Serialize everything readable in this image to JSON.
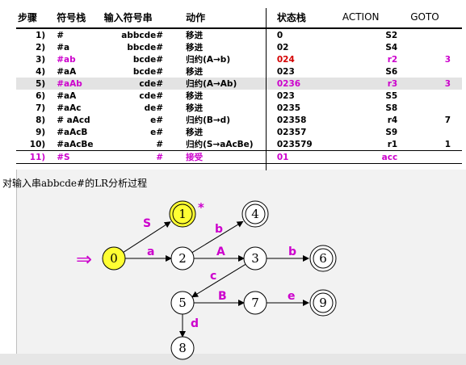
{
  "table": {
    "headers": [
      "步骤",
      "符号栈",
      "输入符号串",
      "动作",
      "状态栈",
      "ACTION",
      "GOTO"
    ],
    "rows": [
      {
        "step": "1)",
        "stack": "#",
        "input": "abbcde#",
        "action": "移进",
        "states": "0",
        "act": "S2",
        "goto": ""
      },
      {
        "step": "2)",
        "stack": "#a",
        "input": "bbcde#",
        "action": "移进",
        "states": "02",
        "act": "S4",
        "goto": ""
      },
      {
        "step": "3)",
        "stack": "#ab",
        "input": "bcde#",
        "action": "归约(A→b)",
        "states": "024",
        "act": "r2",
        "goto": "3"
      },
      {
        "step": "4)",
        "stack": "#aA",
        "input": "bcde#",
        "action": "移进",
        "states": "023",
        "act": "S6",
        "goto": ""
      },
      {
        "step": "5)",
        "stack": "#aAb",
        "input": "cde#",
        "action": "归约(A→Ab)",
        "states": "0236",
        "act": "r3",
        "goto": "3"
      },
      {
        "step": "6)",
        "stack": "#aA",
        "input": "cde#",
        "action": "移进",
        "states": "023",
        "act": "S5",
        "goto": ""
      },
      {
        "step": "7)",
        "stack": "#aAc",
        "input": "de#",
        "action": "移进",
        "states": "0235",
        "act": "S8",
        "goto": ""
      },
      {
        "step": "8)",
        "stack": "# aAcd",
        "input": "e#",
        "action": "归约(B→d)",
        "states": "02358",
        "act": "r4",
        "goto": "7"
      },
      {
        "step": "9)",
        "stack": "#aAcB",
        "input": "e#",
        "action": "移进",
        "states": "02357",
        "act": "S9",
        "goto": ""
      },
      {
        "step": "10)",
        "stack": "#aAcBe",
        "input": "#",
        "action": "归约(S→aAcBe)",
        "states": "023579",
        "act": "r1",
        "goto": "1"
      },
      {
        "step": "11)",
        "stack": "#S",
        "input": "#",
        "action": "接受",
        "states": "01",
        "act": "acc",
        "goto": ""
      }
    ]
  },
  "caption": "对输入串abbcde#的LR分析过程",
  "dfa": {
    "states": [
      "0",
      "1",
      "2",
      "3",
      "4",
      "5",
      "6",
      "7",
      "8",
      "9"
    ],
    "start_marker": "⇒",
    "accept_marker": "*",
    "edges": [
      {
        "from": "0",
        "to": "1",
        "label": "S"
      },
      {
        "from": "0",
        "to": "2",
        "label": "a"
      },
      {
        "from": "2",
        "to": "4",
        "label": "b"
      },
      {
        "from": "2",
        "to": "3",
        "label": "A"
      },
      {
        "from": "3",
        "to": "6",
        "label": "b"
      },
      {
        "from": "3",
        "to": "5",
        "label": "c"
      },
      {
        "from": "5",
        "to": "7",
        "label": "B"
      },
      {
        "from": "7",
        "to": "9",
        "label": "e"
      },
      {
        "from": "5",
        "to": "8",
        "label": "d"
      }
    ]
  },
  "colors": {
    "red": "#d40000",
    "magenta": "#cc00cc",
    "yellow": "#ffff33"
  }
}
